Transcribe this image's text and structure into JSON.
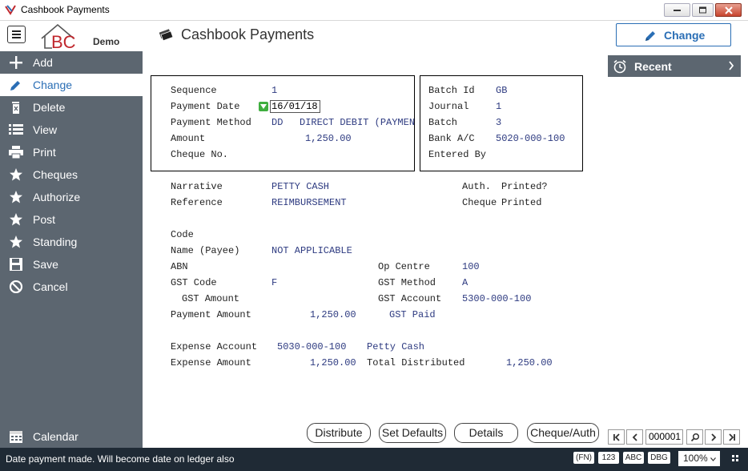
{
  "window": {
    "title": "Cashbook Payments"
  },
  "header": {
    "logo_text": "BC",
    "logo_sub": "Demo",
    "page_title": "Cashbook Payments",
    "change_label": "Change"
  },
  "sidebar": {
    "items": [
      {
        "label": "Add",
        "icon": "plus-icon"
      },
      {
        "label": "Change",
        "icon": "pencil-icon"
      },
      {
        "label": "Delete",
        "icon": "trash-icon"
      },
      {
        "label": "View",
        "icon": "list-icon"
      },
      {
        "label": "Print",
        "icon": "printer-icon"
      },
      {
        "label": "Cheques",
        "icon": "star-icon"
      },
      {
        "label": "Authorize",
        "icon": "star-icon"
      },
      {
        "label": "Post",
        "icon": "star-icon"
      },
      {
        "label": "Standing",
        "icon": "star-icon"
      },
      {
        "label": "Save",
        "icon": "floppy-icon"
      },
      {
        "label": "Cancel",
        "icon": "cancel-icon"
      }
    ],
    "calendar_label": "Calendar"
  },
  "recent": {
    "label": "Recent"
  },
  "form": {
    "sequence_label": "Sequence",
    "sequence": "1",
    "payment_date_label": "Payment Date",
    "payment_date": "16/01/18",
    "payment_method_label": "Payment Method",
    "payment_method_code": "DD",
    "payment_method_desc": "DIRECT DEBIT (PAYMEN",
    "amount_label": "Amount",
    "amount": "1,250.00",
    "cheque_no_label": "Cheque No.",
    "batch_id_label": "Batch Id",
    "batch_id": "GB",
    "journal_label": "Journal",
    "journal": "1",
    "batch_label": "Batch",
    "batch": "3",
    "bank_ac_label": "Bank A/C",
    "bank_ac": "5020-000-100",
    "entered_by_label": "Entered By",
    "narrative_label": "Narrative",
    "narrative": "PETTY CASH",
    "reference_label": "Reference",
    "reference": "REIMBURSEMENT",
    "auth_label": "Auth.",
    "printed_q_label": "Printed?",
    "cheque_label": "Cheque",
    "printed_label": "Printed",
    "code_label": "Code",
    "name_payee_label": "Name (Payee)",
    "name_payee": "NOT APPLICABLE",
    "abn_label": "ABN",
    "op_centre_label": "Op Centre",
    "op_centre": "100",
    "gst_code_label": "GST Code",
    "gst_code": "F",
    "gst_method_label": "GST Method",
    "gst_method": "A",
    "gst_amount_label": "GST Amount",
    "gst_account_label": "GST Account",
    "gst_account": "5300-000-100",
    "payment_amount_label": "Payment Amount",
    "payment_amount": "1,250.00",
    "gst_paid_label": "GST Paid",
    "expense_account_label": "Expense Account",
    "expense_account": "5030-000-100",
    "expense_account_desc": "Petty Cash",
    "expense_amount_label": "Expense Amount",
    "expense_amount": "1,250.00",
    "total_distributed_label": "Total Distributed",
    "total_distributed": "1,250.00"
  },
  "actions": {
    "distribute": "Distribute",
    "set_defaults": "Set Defaults",
    "details": "Details",
    "cheque_auth": "Cheque/Auth"
  },
  "navigator": {
    "record": "000001"
  },
  "status": {
    "message": "Date payment made. Will become date on ledger also",
    "fn": "(FN)",
    "num": "123",
    "caps": "ABC",
    "dbg": "DBG",
    "zoom": "100%"
  },
  "colors": {
    "sidebar_bg": "#5c6670",
    "accent": "#2a6eb5",
    "value_text": "#2d3a80",
    "statusbar_bg": "#1f2a35"
  }
}
